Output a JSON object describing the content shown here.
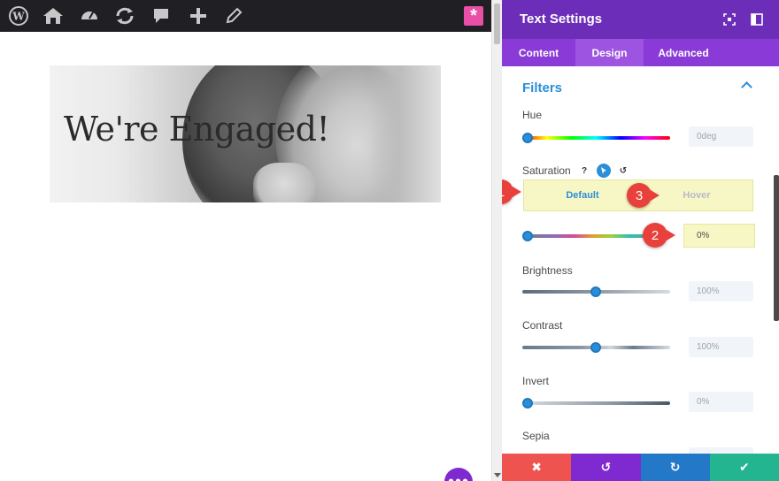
{
  "hero": {
    "title": "We're Engaged!"
  },
  "panel": {
    "title": "Text Settings",
    "tabs": [
      {
        "label": "Content",
        "active": false
      },
      {
        "label": "Design",
        "active": true
      },
      {
        "label": "Advanced",
        "active": false
      }
    ],
    "section_title": "Filters",
    "filters": [
      {
        "label": "Hue",
        "value": "0deg",
        "level": 0
      },
      {
        "label": "Saturation",
        "value": "0%",
        "level": 0
      },
      {
        "label": "Brightness",
        "value": "100%",
        "level": 0.5
      },
      {
        "label": "Contrast",
        "value": "100%",
        "level": 0.5
      },
      {
        "label": "Invert",
        "value": "0%",
        "level": 0
      },
      {
        "label": "Sepia",
        "value": "",
        "level": 0
      }
    ],
    "saturation_states": {
      "default": "Default",
      "hover": "Hover"
    },
    "saturation_icons": {
      "help": "?",
      "undo": "↺"
    },
    "callouts": [
      "1",
      "2",
      "3"
    ]
  },
  "footer": {
    "cancel": "✖",
    "undo": "↺",
    "redo": "↻",
    "save": "✔"
  },
  "fab_label": "•••",
  "colors": {
    "panel_header": "#6c2eb9",
    "tabs_bar": "#8a3ad6",
    "accent_blue": "#2a8fd8",
    "callout_red": "#e8403a",
    "highlight_yellow": "#f7f7c6",
    "cancel": "#ef5350",
    "undo": "#7e2ad0",
    "redo": "#2378c8",
    "save": "#22b58f"
  },
  "icons": {
    "adminbar": [
      "wordpress-icon",
      "home-icon",
      "dashboard-icon",
      "updates-icon",
      "comments-icon",
      "add-new-icon",
      "edit-icon"
    ],
    "adminbar_right": "divi-star-icon"
  }
}
